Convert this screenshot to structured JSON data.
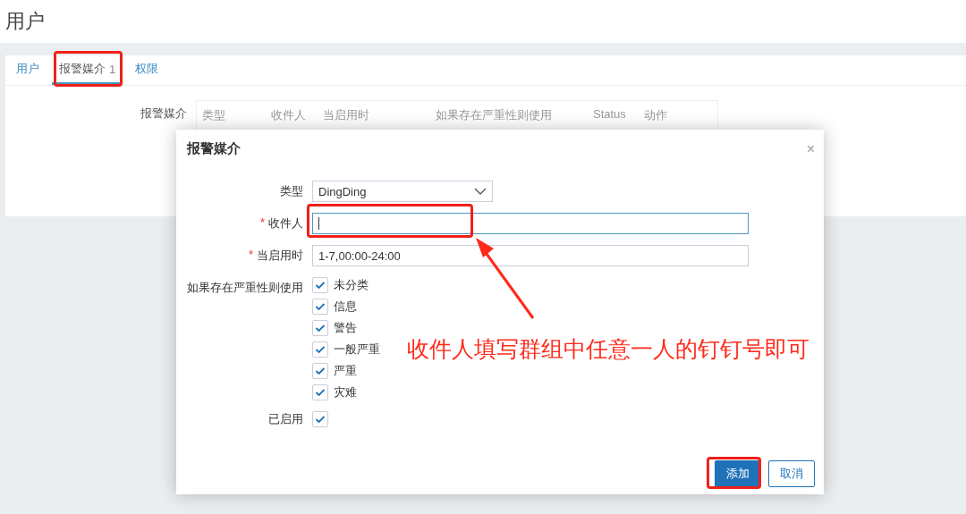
{
  "page_title": "用户",
  "tabs": [
    {
      "label": "用户",
      "selected": false
    },
    {
      "label": "报警媒介",
      "count": "1",
      "selected": true
    },
    {
      "label": "权限",
      "selected": false
    }
  ],
  "media_table": {
    "label": "报警媒介",
    "columns": [
      "类型",
      "收件人",
      "当启用时",
      "如果存在严重性则使用",
      "Status",
      "动作"
    ]
  },
  "dialog": {
    "title": "报警媒介",
    "close": "×",
    "fields": [
      {
        "kind": "select",
        "label": "类型",
        "value": "DingDing"
      },
      {
        "kind": "text",
        "label": "收件人",
        "required_mark": "*",
        "focused": true
      },
      {
        "kind": "text",
        "label": "当启用时",
        "required_mark": "*",
        "focused": false,
        "value": "1-7,00:00-24:00"
      }
    ],
    "severity": {
      "label": "如果存在严重性则使用",
      "options": [
        {
          "label": "未分类",
          "checked": true
        },
        {
          "label": "信息",
          "checked": true
        },
        {
          "label": "警告",
          "checked": true
        },
        {
          "label": "一般严重",
          "checked": true
        },
        {
          "label": "严重",
          "checked": true
        },
        {
          "label": "灾难",
          "checked": true
        }
      ]
    },
    "enabled": {
      "label": "已启用",
      "checked": true
    },
    "buttons": [
      {
        "label": "添加",
        "kind": "primary"
      },
      {
        "label": "取消",
        "kind": "secondary"
      }
    ]
  },
  "annotation": {
    "text": "收件人填写群组中任意一人的钉钉号即可"
  }
}
